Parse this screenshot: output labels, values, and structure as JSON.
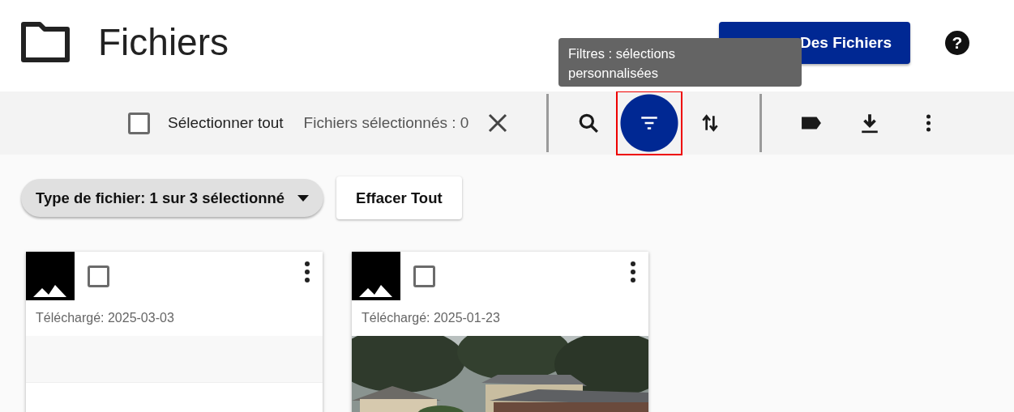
{
  "header": {
    "title": "Fichiers",
    "action_button": "Des Fichiers",
    "help_label": "?"
  },
  "toolbar": {
    "select_all": {
      "label": "Sélectionner tout",
      "checked": false
    },
    "selected_count": "Fichiers sélectionnés : 0",
    "tools": [
      {
        "kind": "search",
        "selected": false,
        "highlighted": false
      },
      {
        "kind": "filter",
        "selected": true,
        "highlighted": true
      },
      {
        "kind": "sort",
        "selected": false,
        "highlighted": false
      },
      {
        "kind": "divider"
      },
      {
        "kind": "label",
        "selected": false,
        "highlighted": false
      },
      {
        "kind": "download",
        "selected": false,
        "highlighted": false
      },
      {
        "kind": "more",
        "selected": false,
        "highlighted": false
      }
    ]
  },
  "tooltip": "Filtres : sélections personnalisées",
  "filters": {
    "chip": "Type de fichier: 1 sur 3 sélectionné",
    "clear_button": "Effacer Tout"
  },
  "cards": [
    {
      "uploaded": "Téléchargé: 2025-03-03",
      "checked": false,
      "kind": "empty"
    },
    {
      "uploaded": "Téléchargé: 2025-01-23",
      "checked": false,
      "kind": "picture"
    }
  ]
}
